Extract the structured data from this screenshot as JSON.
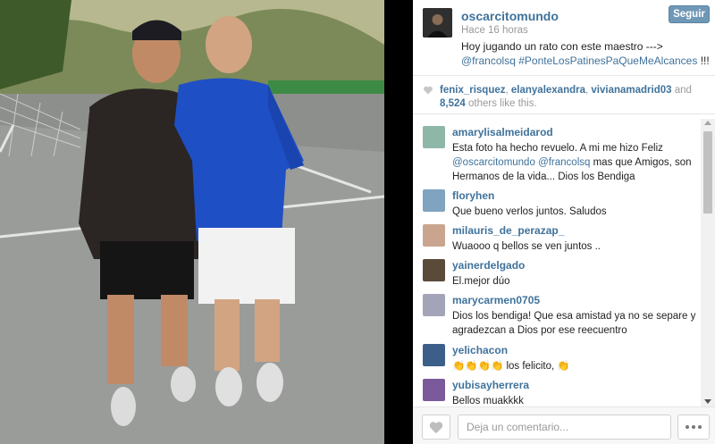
{
  "post": {
    "username": "oscarcitomundo",
    "time": "Hace 16 horas",
    "follow_label": "Seguir",
    "caption_text": "Hoy jugando un rato con este maestro ---> ",
    "caption_mention": "@francolsq",
    "caption_hashtag": "#PonteLosPatinesPaQueMeAlcances",
    "caption_end": " !!!"
  },
  "likes": {
    "users": [
      "fenix_risquez",
      "elanyalexandra",
      "vivianamadrid03"
    ],
    "sep": ", ",
    "and": " and",
    "count": "8,524",
    "suffix": " others like this."
  },
  "comments": [
    {
      "user": "amarylisalmeidarod",
      "text_a": "Esta foto ha hecho revuelo. A mi me hizo Feliz ",
      "mention_a": "@oscarcitomundo",
      "mention_b": "@francolsq",
      "text_b": " mas que Amigos, son Hermanos de la vida... Dios los Bendiga"
    },
    {
      "user": "floryhen",
      "text": "Que bueno verlos juntos. Saludos"
    },
    {
      "user": "milauris_de_perazap_",
      "text": "Wuaooo q bellos se ven juntos .."
    },
    {
      "user": "yainerdelgado",
      "text": "El.mejor dúo"
    },
    {
      "user": "marycarmen0705",
      "text": "Dios los bendiga! Que esa amistad ya no se separe y agradezcan a Dios por ese reecuentro"
    },
    {
      "user": "yelichacon",
      "text": "👏👏👏👏 los felicito, 👏"
    },
    {
      "user": "yubisayherrera",
      "text": "Bellos muakkkk"
    }
  ],
  "footer": {
    "comment_placeholder": "Deja un comentario..."
  },
  "colors": {
    "link": "#3f729b",
    "follow_bg": "#6f97b6"
  },
  "icons": {
    "like": "heart-icon",
    "more": "ellipsis-icon"
  }
}
